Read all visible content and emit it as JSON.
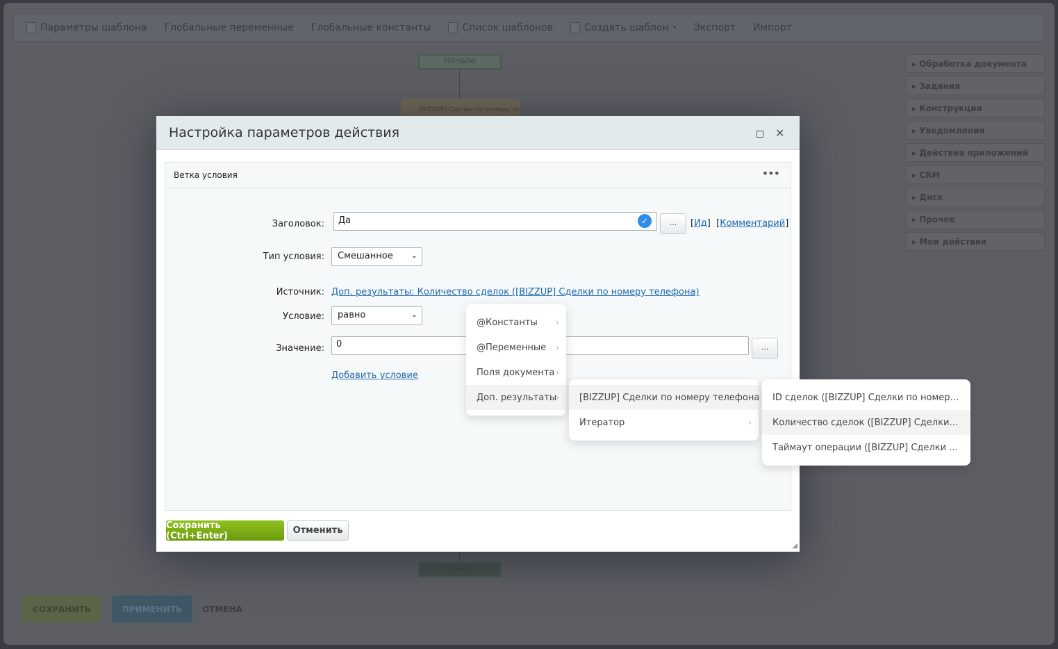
{
  "toolbar": {
    "items": [
      "Параметры шаблона",
      "Глобальные переменные",
      "Глобальные константы",
      "Список шаблонов",
      "Создать шаблон",
      "Экспорт",
      "Импорт"
    ]
  },
  "sidebar": {
    "groups": [
      "Обработка документа",
      "Задания",
      "Конструкции",
      "Уведомления",
      "Действия приложений",
      "CRM",
      "Диск",
      "Прочее",
      "Мои действия"
    ]
  },
  "canvas": {
    "start": "Начало",
    "end": "Конец",
    "activity": "[BIZZUP] Сделки по номеру телефона"
  },
  "bottom": {
    "save": "СОХРАНИТЬ",
    "apply": "ПРИМЕНИТЬ",
    "cancel": "ОТМЕНА"
  },
  "dialog": {
    "title": "Настройка параметров действия",
    "panel_title": "Ветка условия",
    "title_label": "Заголовок:",
    "title_value": "Да",
    "id_link": "Ид",
    "comment_link": "Комментарий",
    "type_label": "Тип условия:",
    "type_value": "Смешанное",
    "source_label": "Источник:",
    "source_value": "Доп. результаты: Количество сделок ([BIZZUP] Сделки по номеру телефона)",
    "cond_label": "Условие:",
    "cond_value": "равно",
    "value_label": "Значение:",
    "value_value": "0",
    "add_condition": "Добавить условие",
    "dots": "...",
    "save": "Сохранить (Ctrl+Enter)",
    "cancel": "Отменить"
  },
  "menu1": [
    "@Константы",
    "@Переменные",
    "Поля документа",
    "Доп. результаты"
  ],
  "menu2": [
    "[BIZZUP] Сделки по номеру телефона",
    "Итератор"
  ],
  "menu3": [
    "ID сделок ([BIZZUP] Сделки по номеру телефона)",
    "Количество сделок ([BIZZUP] Сделки по номеру телефона)",
    "Таймаут операции ([BIZZUP] Сделки по номеру телефона)"
  ]
}
